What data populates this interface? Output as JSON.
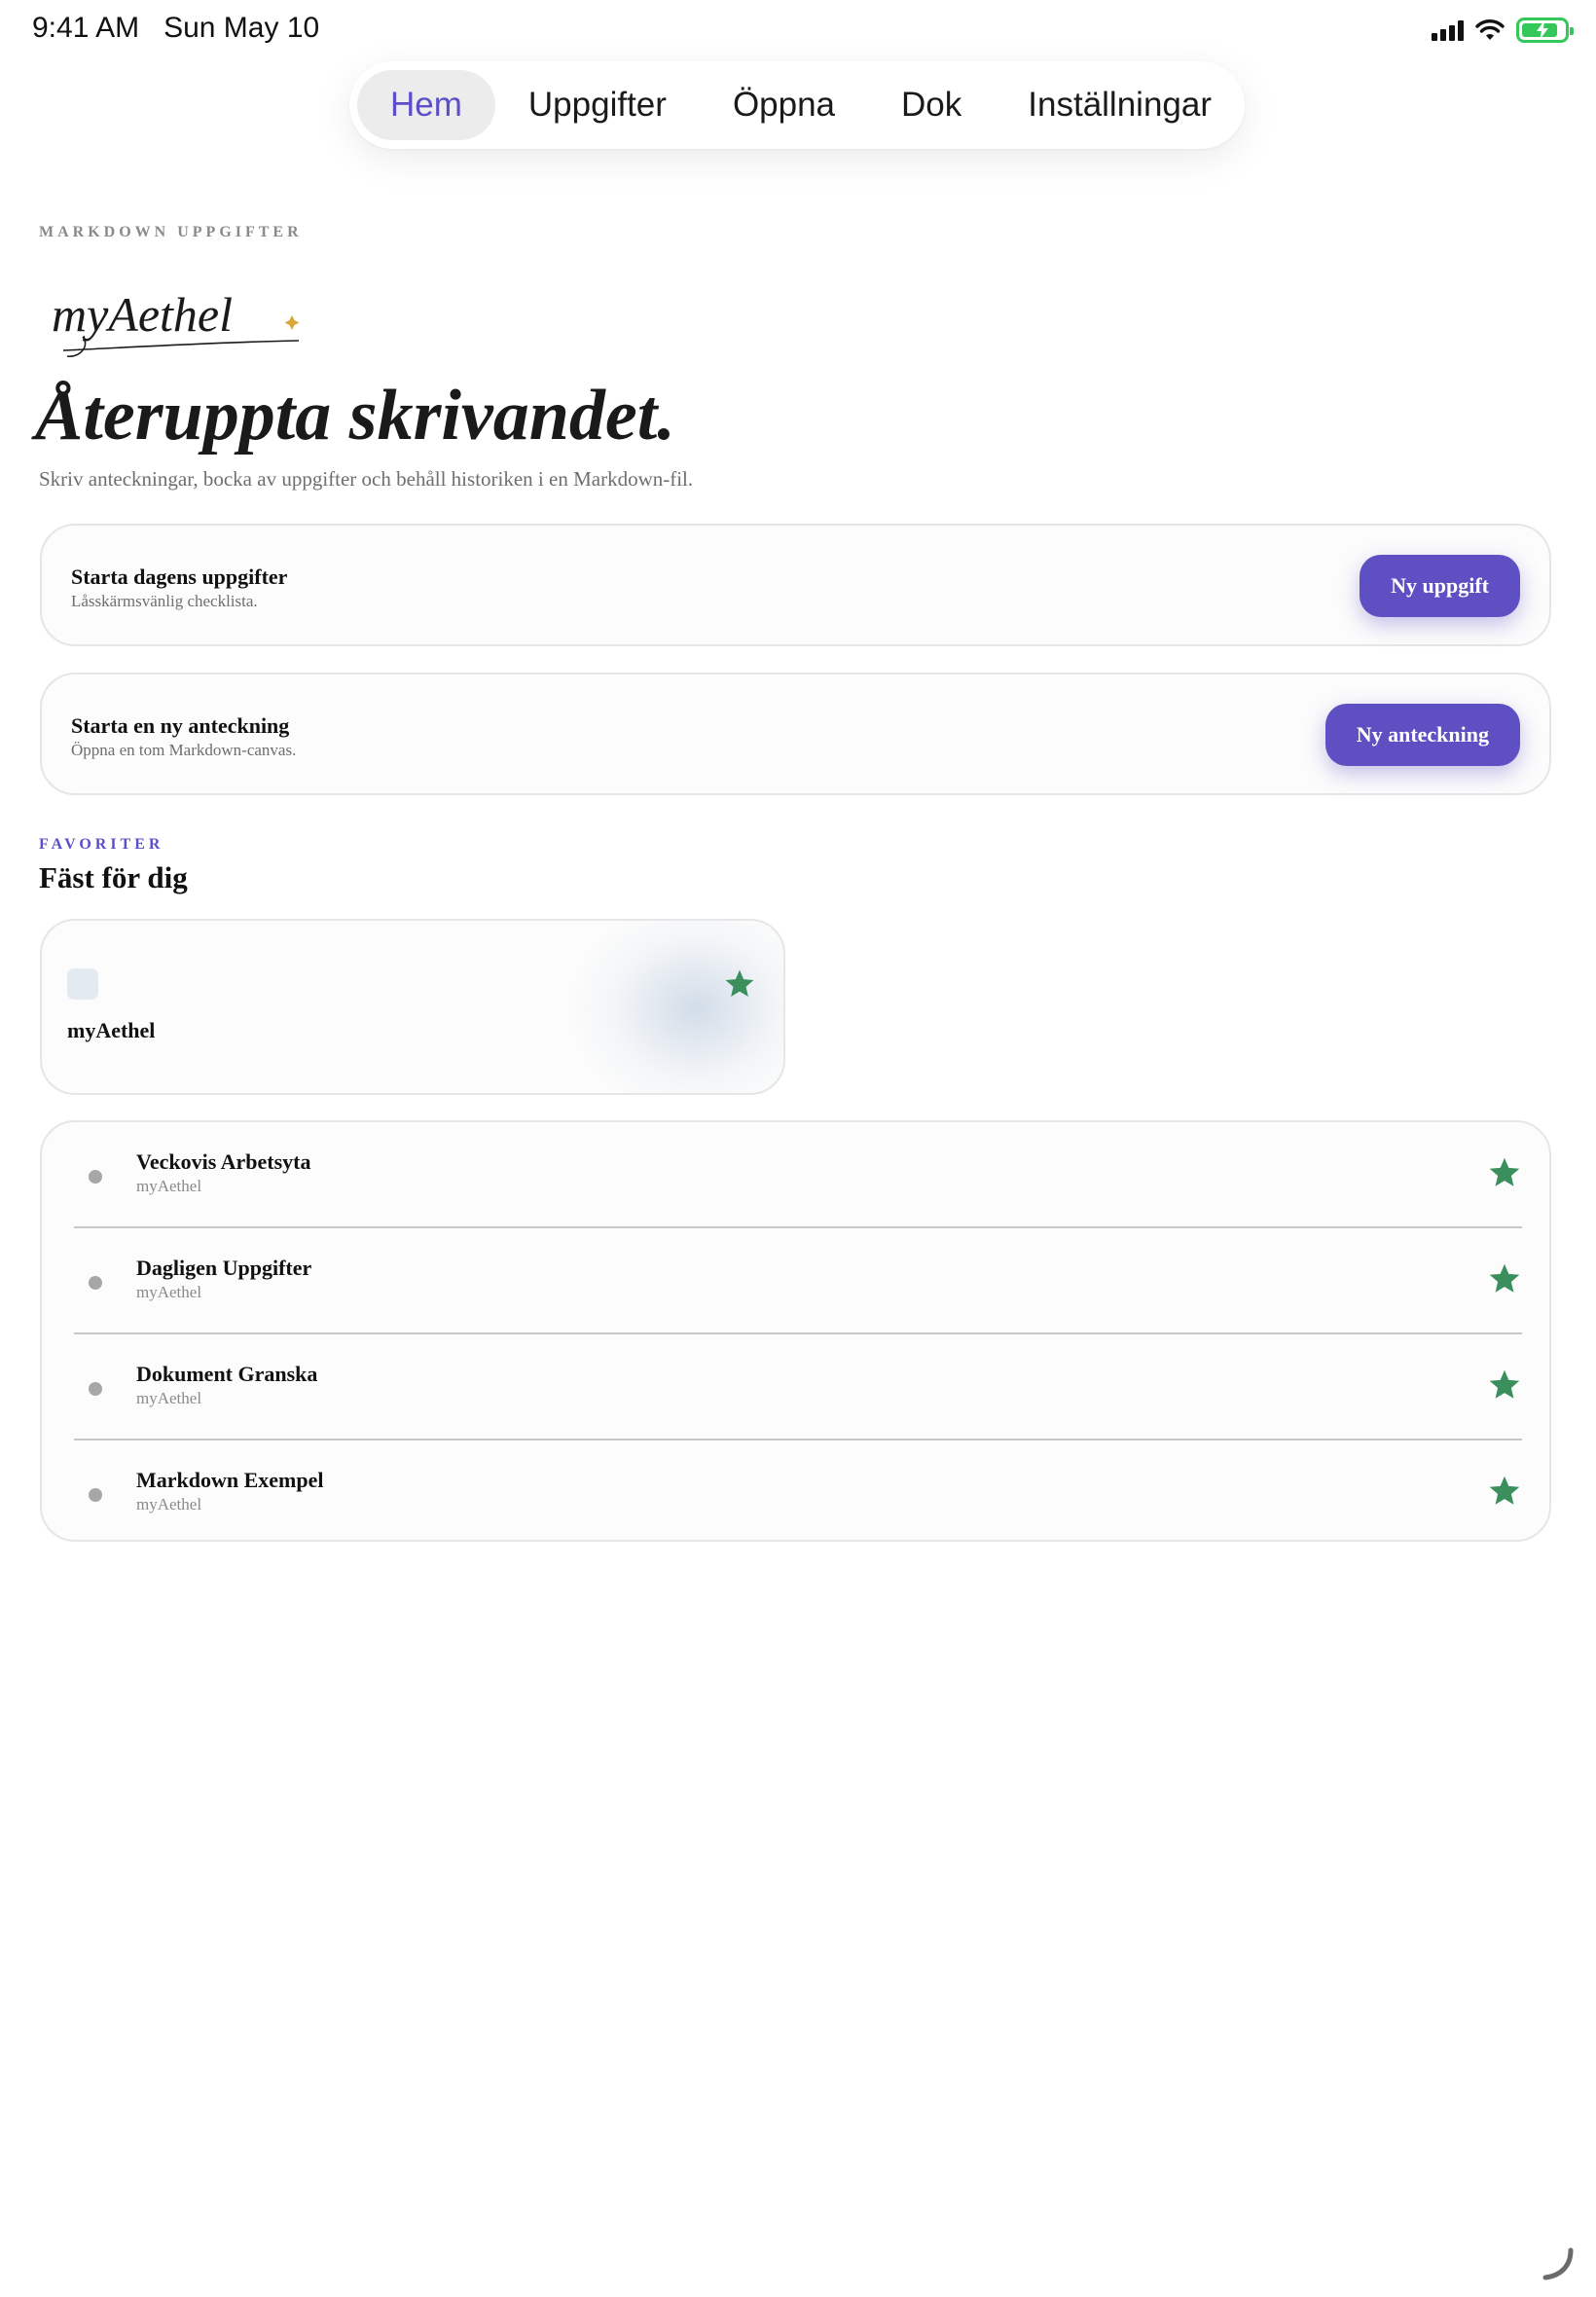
{
  "status": {
    "time": "9:41 AM",
    "date": "Sun May 10",
    "icons": [
      "cellular-signal-icon",
      "wifi-icon",
      "battery-charging-icon"
    ]
  },
  "tabs": [
    {
      "label": "Hem",
      "active": true
    },
    {
      "label": "Uppgifter",
      "active": false
    },
    {
      "label": "Öppna",
      "active": false
    },
    {
      "label": "Dok",
      "active": false
    },
    {
      "label": "Inställningar",
      "active": false
    }
  ],
  "hero": {
    "eyebrow": "MARKDOWN UPPGIFTER",
    "logo_text": "myAethel",
    "headline": "Återuppta skrivandet.",
    "lede": "Skriv anteckningar, bocka av uppgifter och behåll historiken i en Markdown-fil."
  },
  "actions": [
    {
      "title": "Starta dagens uppgifter",
      "subtitle": "Låsskärmsvänlig checklista.",
      "button": "Ny uppgift"
    },
    {
      "title": "Starta en ny anteckning",
      "subtitle": "Öppna en tom Markdown-canvas.",
      "button": "Ny anteckning"
    }
  ],
  "favorites": {
    "eyebrow": "FAVORITER",
    "title": "Fäst för dig",
    "card": {
      "name": "myAethel",
      "starred": true
    },
    "items": [
      {
        "title": "Veckovis Arbetsyta",
        "subtitle": "myAethel",
        "starred": true
      },
      {
        "title": "Dagligen Uppgifter",
        "subtitle": "myAethel",
        "starred": true
      },
      {
        "title": "Dokument Granska",
        "subtitle": "myAethel",
        "starred": true
      },
      {
        "title": "Markdown Exempel",
        "subtitle": "myAethel",
        "starred": true
      }
    ]
  },
  "colors": {
    "accent": "#5e50c2",
    "active_tab_text": "#5a4fc8",
    "star": "#3a8f5c",
    "battery": "#34c759"
  }
}
